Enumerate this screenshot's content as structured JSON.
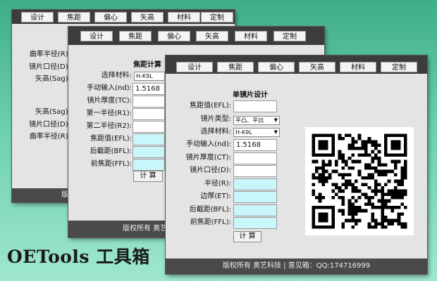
{
  "colors": {
    "toolbar": "#3c3c3c",
    "footer": "#4a4a4a",
    "cyan_field": "#c9f6fb",
    "background": "#6cd0ad"
  },
  "window1": {
    "tabs": [
      "设计",
      "焦距",
      "偏心",
      "矢高",
      "材料",
      "定制"
    ],
    "labels_top": [
      "曲率半径(R):",
      "镜片口径(D):",
      "矢高(Sag):"
    ],
    "labels_bottom": [
      "矢高(Sag):",
      "镜片口径(D):",
      "曲率半径(R):"
    ],
    "footer": "版权"
  },
  "window2": {
    "tabs": [
      "设计",
      "焦距",
      "偏心",
      "矢高",
      "材料",
      "定制"
    ],
    "title": "焦距计算",
    "material_label": "选择材料:",
    "material_value": "H-K9L",
    "manual_label": "手动输入(nd):",
    "manual_value": "1.5168",
    "fields": [
      "镜片厚度(TC):",
      "第一半径(R1):",
      "第二半径(R2):"
    ],
    "results": [
      "焦距值(EFL):",
      "后截距(BFL):",
      "前焦距(FFL):"
    ],
    "calc": "计 算",
    "footer": "版权所有 奥艺"
  },
  "window3": {
    "tabs": [
      "设计",
      "焦距",
      "偏心",
      "矢高",
      "材料",
      "定制"
    ],
    "title": "单镜片设计",
    "efl_label": "焦距值(EFL):",
    "type_label": "镜片类型:",
    "type_value": "平凸、平凹",
    "material_label": "选择材料:",
    "material_value": "H-K9L",
    "manual_label": "手动输入(nd):",
    "manual_value": "1.5168",
    "ct_label": "镜片厚度(CT):",
    "d_label": "镜片口径(D):",
    "results": [
      "半径(R):",
      "边厚(ET):",
      "后截距(BFL):",
      "前焦距(FFL):"
    ],
    "calc": "计 算",
    "footer": "版权所有 奥艺科技 | 意见箱：QQ:174716999"
  },
  "brand": {
    "en": "OETools",
    "cn": "工具箱"
  },
  "icons": {
    "qr": "qr-code-icon"
  }
}
